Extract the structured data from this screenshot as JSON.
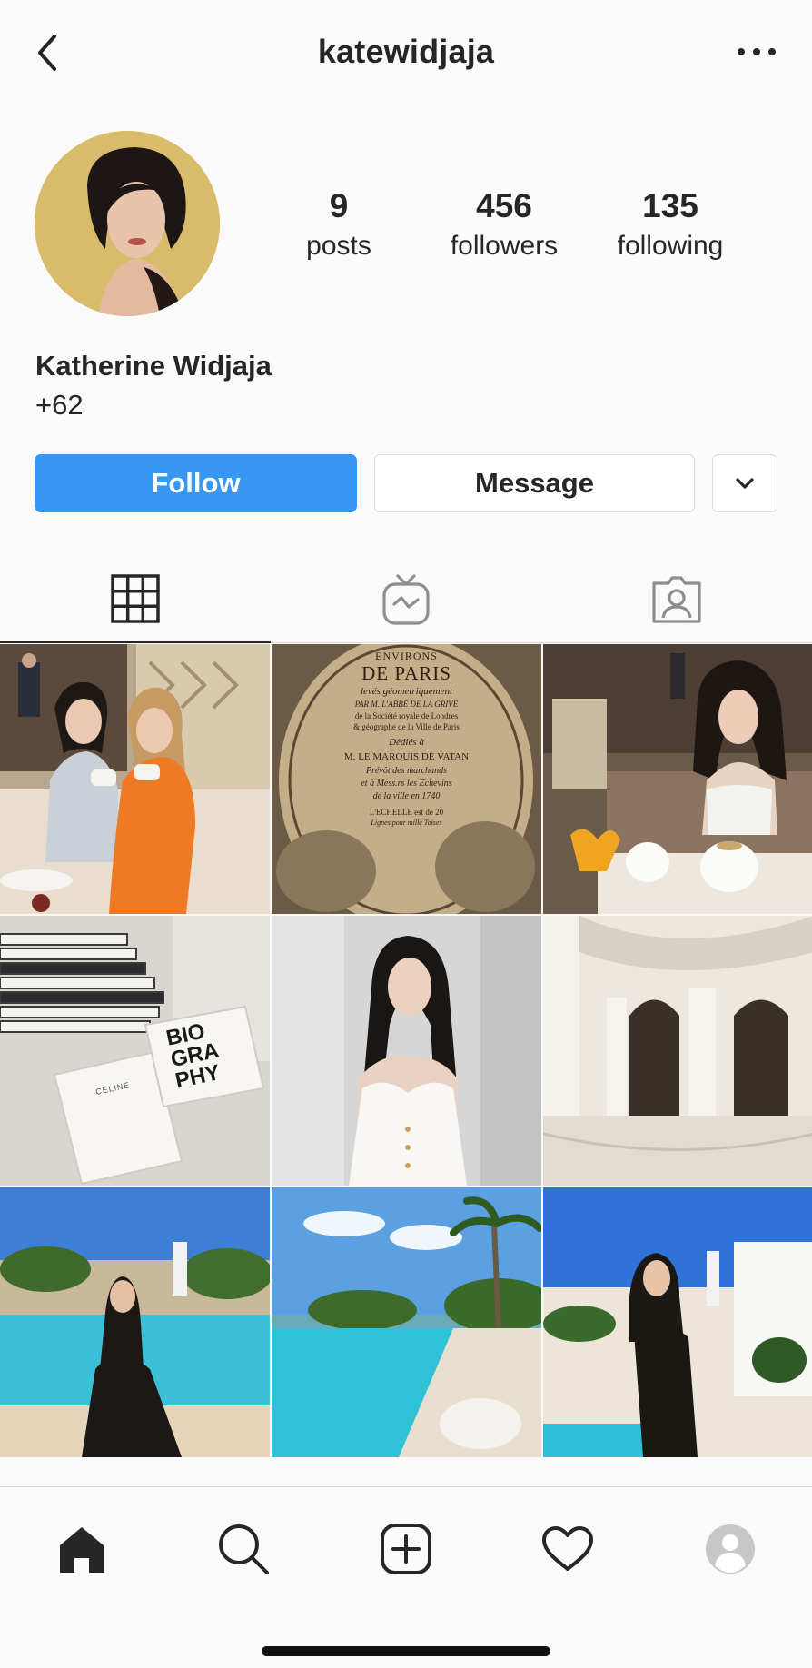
{
  "header": {
    "username": "katewidjaja",
    "back_icon": "chevron-left-icon",
    "more_icon": "ellipsis-icon"
  },
  "profile": {
    "full_name": "Katherine Widjaja",
    "bio": "+62",
    "stats": {
      "posts": {
        "value": "9",
        "label": "posts"
      },
      "followers": {
        "value": "456",
        "label": "followers"
      },
      "following": {
        "value": "135",
        "label": "following"
      }
    }
  },
  "actions": {
    "follow_label": "Follow",
    "message_label": "Message",
    "dropdown_icon": "chevron-down-icon",
    "follow_color": "#3897f0"
  },
  "tabs": [
    {
      "name": "grid",
      "icon": "grid-icon",
      "active": true
    },
    {
      "name": "igtv",
      "icon": "igtv-icon",
      "active": false
    },
    {
      "name": "tagged",
      "icon": "tagged-icon",
      "active": false
    }
  ],
  "posts": [
    {
      "subject": "two women drinking tea"
    },
    {
      "subject": "antique map title page",
      "caption_lines": [
        "ENVIRONS",
        "DE PARIS",
        "levés géometriquement",
        "PAR M. L'ABBÉ DE LA GRIVE",
        "de la Société royale de Londres",
        "& géographe de la Ville de Paris",
        "Dédiés à",
        "M. LE MARQUIS DE VATAN",
        "Prévôt des marchands",
        "et à Mess.rs les Echevins",
        "de la ville en 1740",
        "L'ECHELLE est de 20",
        "Lignes pour mille Toises"
      ]
    },
    {
      "subject": "woman at afternoon tea"
    },
    {
      "subject": "stack of books",
      "book_title": [
        "BIO",
        "GRA",
        "PHY"
      ],
      "book_brand": "CELINE"
    },
    {
      "subject": "portrait in white dress"
    },
    {
      "subject": "white arched architecture"
    },
    {
      "subject": "woman by the pool"
    },
    {
      "subject": "infinity pool with palm trees"
    },
    {
      "subject": "woman posing at resort"
    }
  ],
  "tabbar": [
    {
      "name": "home",
      "icon": "home-icon"
    },
    {
      "name": "search",
      "icon": "search-icon"
    },
    {
      "name": "new-post",
      "icon": "plus-square-icon"
    },
    {
      "name": "activity",
      "icon": "heart-icon"
    },
    {
      "name": "profile",
      "icon": "profile-avatar-icon"
    }
  ]
}
